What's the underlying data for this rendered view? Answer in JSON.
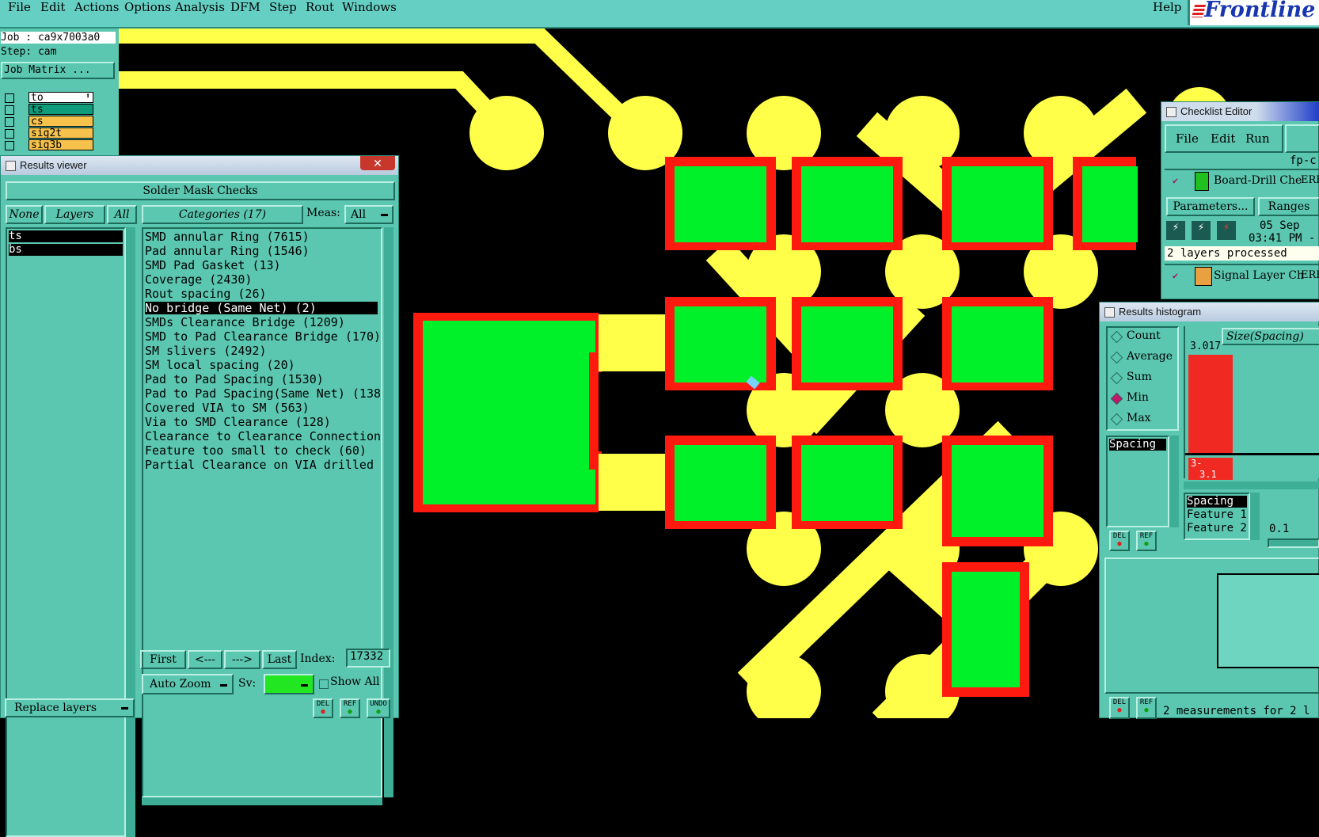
{
  "menu": {
    "items": [
      "File",
      "Edit",
      "Actions",
      "Options",
      "Analysis",
      "DFM",
      "Step",
      "Rout",
      "Windows"
    ],
    "help": "Help",
    "brand": "Frontline"
  },
  "job": {
    "job_line": "Job : ca9x7003a0",
    "step_line": "Step: cam",
    "matrix_button": "Job Matrix ..."
  },
  "layers": [
    {
      "name": "to",
      "color": "#ffffff",
      "marker": "⬆"
    },
    {
      "name": "ts",
      "color": "#0e9c7a",
      "marker": ""
    },
    {
      "name": "cs",
      "color": "#f7c24c",
      "marker": ""
    },
    {
      "name": "sig2t",
      "color": "#f7c24c",
      "marker": ""
    },
    {
      "name": "sig3b",
      "color": "#f7c24c",
      "marker": ""
    }
  ],
  "results_viewer": {
    "title": "Results viewer",
    "header": "Solder Mask Checks",
    "none_btn": "None",
    "layers_btn": "Layers",
    "all_btn": "All",
    "layer_list": [
      "ts",
      "bs"
    ],
    "categories_btn": "Categories (17)",
    "meas_label": "Meas:",
    "meas_value": "All",
    "categories": [
      "SMD annular Ring (7615)",
      "Pad annular Ring (1546)",
      "SMD Pad Gasket (13)",
      "Coverage (2430)",
      "Rout spacing (26)",
      "No bridge (Same Net) (2)",
      "SMDs Clearance Bridge (1209)",
      "SMD to Pad Clearance Bridge (170)",
      "SM slivers (2492)",
      "SM local spacing (20)",
      "Pad to Pad Spacing (1530)",
      "Pad to Pad Spacing(Same Net) (138",
      "Covered VIA to SM (563)",
      "Via to SMD Clearance (128)",
      "Clearance to Clearance Connection",
      "Feature too small to check (60)",
      "Partial Clearance on VIA drilled"
    ],
    "selected_index": 5,
    "nav": {
      "first": "First",
      "prev": "<---",
      "next": "--->",
      "last": "Last",
      "index_label": "Index:",
      "index_value": "17332"
    },
    "auto_zoom": "Auto Zoom",
    "sv_label": "Sv:",
    "show_all": "Show All",
    "replace_layers": "Replace layers",
    "del": "DEL",
    "ref": "REF",
    "undo": "UNDO"
  },
  "checklist_editor": {
    "title": "Checklist Editor",
    "menu": [
      "File",
      "Edit",
      "Run"
    ],
    "fp_label": "fp-c",
    "item1": "Board-Drill Che",
    "erf": "ERF",
    "parameters_btn": "Parameters...",
    "ranges_btn": "Ranges",
    "date": "05 Sep",
    "time": "03:41 PM -",
    "status": "2 layers processed",
    "item2": "Signal Layer Ch"
  },
  "histogram": {
    "title": "Results histogram",
    "options": [
      "Count",
      "Average",
      "Sum",
      "Min",
      "Max"
    ],
    "selected_option": "Min",
    "list": [
      "Spacing"
    ],
    "size_label": "Size(Spacing)",
    "bar_value": "3.017",
    "bin_label_a": "3-",
    "bin_label_b": "3.1",
    "features": [
      "Spacing",
      "Feature 1",
      "Feature 2"
    ],
    "step_value": "0.1",
    "footer": "2 measurements for 2 l",
    "del": "DEL",
    "ref": "REF",
    "bar_color": "#f02a22"
  },
  "colors": {
    "board_bg": "#000000",
    "copper": "#ffff4a",
    "mask": "#00f02a",
    "clearance": "#ff1a10",
    "panel": "#5cc7b0"
  }
}
